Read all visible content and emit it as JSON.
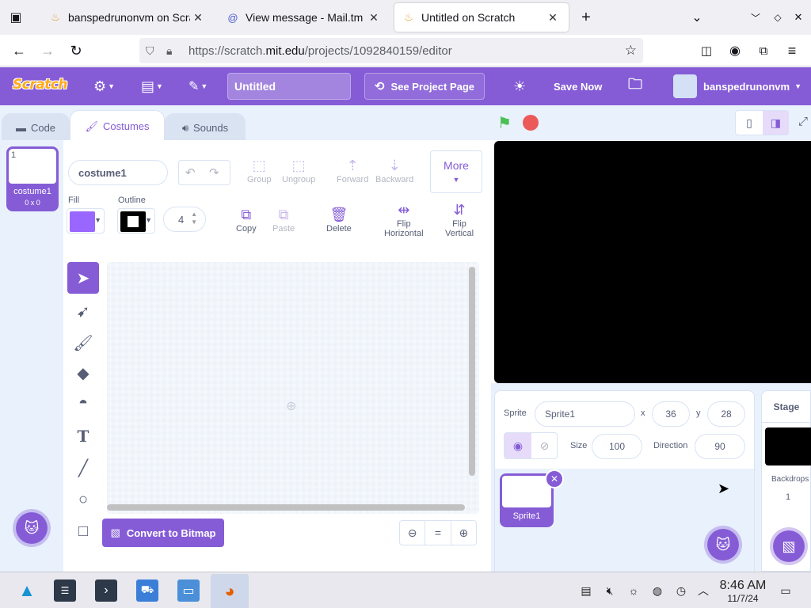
{
  "browser": {
    "tabs": [
      {
        "title": "banspedrunonvm on Scratch",
        "icon": "scratch-favicon"
      },
      {
        "title": "View message - Mail.tm",
        "icon": "mailtm-favicon"
      },
      {
        "title": "Untitled on Scratch",
        "icon": "scratch-favicon",
        "active": true
      }
    ],
    "new_tab": "+",
    "url_prefix": "https://scratch.",
    "url_domain": "mit.edu",
    "url_path": "/projects/1092840159/editor"
  },
  "scratch_menu": {
    "logo": "Scratch",
    "project_title": "Untitled",
    "see_project_page": "See Project Page",
    "save_now": "Save Now",
    "username": "banspedrunonvm",
    "accent": "#855cd6"
  },
  "editor_tabs": {
    "code": "Code",
    "costumes": "Costumes",
    "sounds": "Sounds"
  },
  "costume_list": {
    "items": [
      {
        "number": "1",
        "name": "costume1",
        "size": "0 x 0"
      }
    ]
  },
  "paint": {
    "costume_name": "costume1",
    "group": "Group",
    "ungroup": "Ungroup",
    "forward": "Forward",
    "backward": "Backward",
    "more": "More",
    "fill_label": "Fill",
    "outline_label": "Outline",
    "fill_color": "#9966ff",
    "outline_color": "#000000",
    "stroke_width": "4",
    "copy": "Copy",
    "paste": "Paste",
    "delete": "Delete",
    "flip_horizontal_1": "Flip",
    "flip_horizontal_2": "Horizontal",
    "flip_vertical_1": "Flip",
    "flip_vertical_2": "Vertical",
    "convert_to_bitmap": "Convert to Bitmap",
    "zoom_reset": "="
  },
  "sprite_info": {
    "sprite_label": "Sprite",
    "sprite_name": "Sprite1",
    "x_label": "x",
    "x": "36",
    "y_label": "y",
    "y": "28",
    "size_label": "Size",
    "size": "100",
    "direction_label": "Direction",
    "direction": "90",
    "sprites": [
      {
        "name": "Sprite1"
      }
    ]
  },
  "stage_panel": {
    "title": "Stage",
    "backdrops_label": "Backdrops",
    "backdrops_count": "1"
  },
  "taskbar": {
    "time": "8:46 AM",
    "date": "11/7/24"
  }
}
